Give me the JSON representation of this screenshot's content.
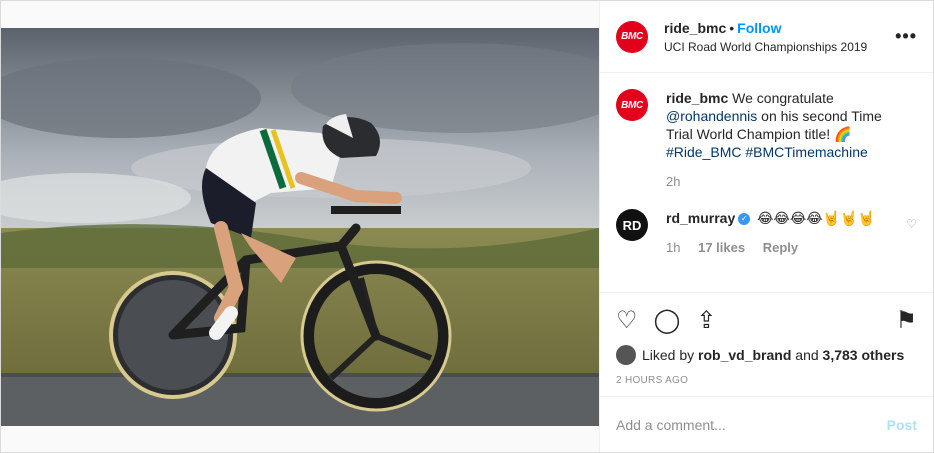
{
  "post": {
    "author": "ride_bmc",
    "avatar_text": "BMC",
    "dot": "•",
    "follow_label": "Follow",
    "location": "UCI Road World Championships 2019",
    "more_label": "•••"
  },
  "caption": {
    "author": "ride_bmc",
    "text_1": "We congratulate",
    "mention": "@rohandennis",
    "text_2": "on his second Time Trial World Champion title! 🌈",
    "hashtag_1": "#Ride_BMC",
    "hashtag_2": "#BMCTimemachine",
    "age": "2h"
  },
  "comment": {
    "author": "rd_murray",
    "avatar_text": "RD",
    "verified_mark": "✓",
    "text": "😂😂😂😂🤘🤘🤘",
    "age": "1h",
    "likes": "17 likes",
    "reply_label": "Reply",
    "like_icon": "♡"
  },
  "actions": {
    "like_icon": "♡",
    "comment_icon": "◯",
    "share_icon": "⇪",
    "save_icon": "⚑"
  },
  "likes": {
    "prefix": "Liked by",
    "user": "rob_vd_brand",
    "and": "and",
    "others": "3,783 others"
  },
  "timestamp": "2 HOURS AGO",
  "add_comment": {
    "placeholder": "Add a comment...",
    "post_label": "Post"
  },
  "colors": {
    "brand_red": "#e2001a",
    "link_blue": "#0095f6",
    "muted": "#8e8e8e"
  }
}
